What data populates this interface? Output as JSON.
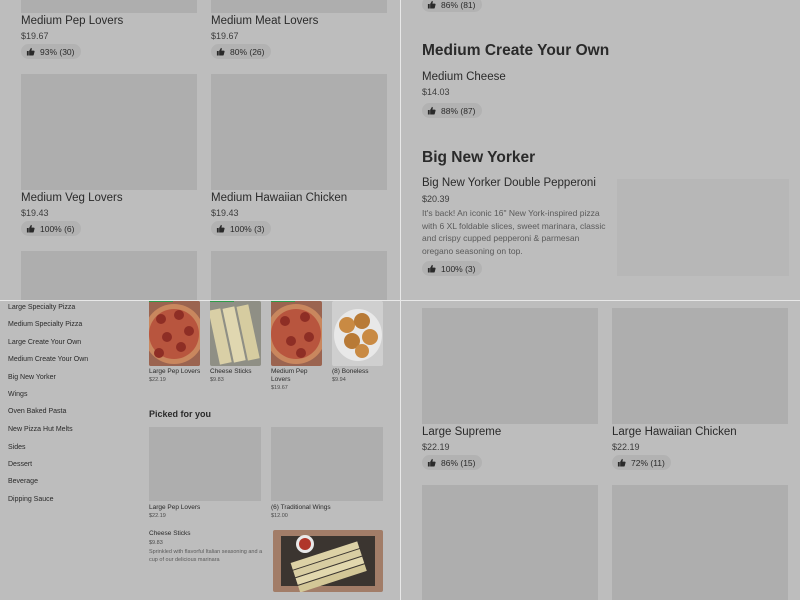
{
  "q1": {
    "row1": [
      {
        "name": "Medium Pep Lovers",
        "price": "$19.67",
        "rating": "93% (30)"
      },
      {
        "name": "Medium Meat Lovers",
        "price": "$19.67",
        "rating": "80% (26)"
      }
    ],
    "row2": [
      {
        "name": "Medium Veg Lovers",
        "price": "$19.43",
        "rating": "100% (6)"
      },
      {
        "name": "Medium Hawaiian Chicken",
        "price": "$19.43",
        "rating": "100% (3)"
      }
    ]
  },
  "q2": {
    "top_rating": "86% (81)",
    "section1": "Medium Create Your Own",
    "item1": {
      "name": "Medium Cheese",
      "price": "$14.03",
      "rating": "88% (87)"
    },
    "section2": "Big New Yorker",
    "item2": {
      "name": "Big New Yorker Double Pepperoni",
      "price": "$20.39",
      "desc": "It's back! An iconic 16\" New York-inspired pizza with 6 XL foldable slices, sweet marinara, classic and crispy cupped pepperoni & parmesan oregano seasoning on top.",
      "rating": "100% (3)"
    }
  },
  "q3": {
    "nav": [
      "Large Specialty Pizza",
      "Medium Specialty Pizza",
      "Large Create Your Own",
      "Medium Create Your Own",
      "Big New Yorker",
      "Wings",
      "Oven Baked Pasta",
      "New Pizza Hut Melts",
      "Sides",
      "Dessert",
      "Beverage",
      "Dipping Sauce"
    ],
    "featured": [
      {
        "name": "Large Pep Lovers",
        "price": "$22.19"
      },
      {
        "name": "Cheese Sticks",
        "price": "$9.83"
      },
      {
        "name": "Medium Pep Lovers",
        "price": "$19.67"
      },
      {
        "name": "(8) Boneless",
        "price": "$9.94"
      }
    ],
    "picked_heading": "Picked for you",
    "picked": [
      {
        "name": "Large Pep Lovers",
        "price": "$22.19"
      },
      {
        "name": "(6) Traditional Wings",
        "price": "$12.00"
      }
    ],
    "cheese": {
      "name": "Cheese Sticks",
      "price": "$9.83",
      "desc": "Sprinkled with flavorful Italian seasoning and a cup of our delicious marinara"
    }
  },
  "q4": {
    "items": [
      {
        "name": "Large Supreme",
        "price": "$22.19",
        "rating": "86% (15)"
      },
      {
        "name": "Large Hawaiian Chicken",
        "price": "$22.19",
        "rating": "72% (11)"
      }
    ]
  },
  "colors": {
    "background": "#bdbdbd",
    "placeholder": "#aeaeae",
    "divider": "#e8e8e8",
    "badge": "#2e9b4a"
  },
  "icons": {
    "rating": "thumbs-up-icon"
  }
}
